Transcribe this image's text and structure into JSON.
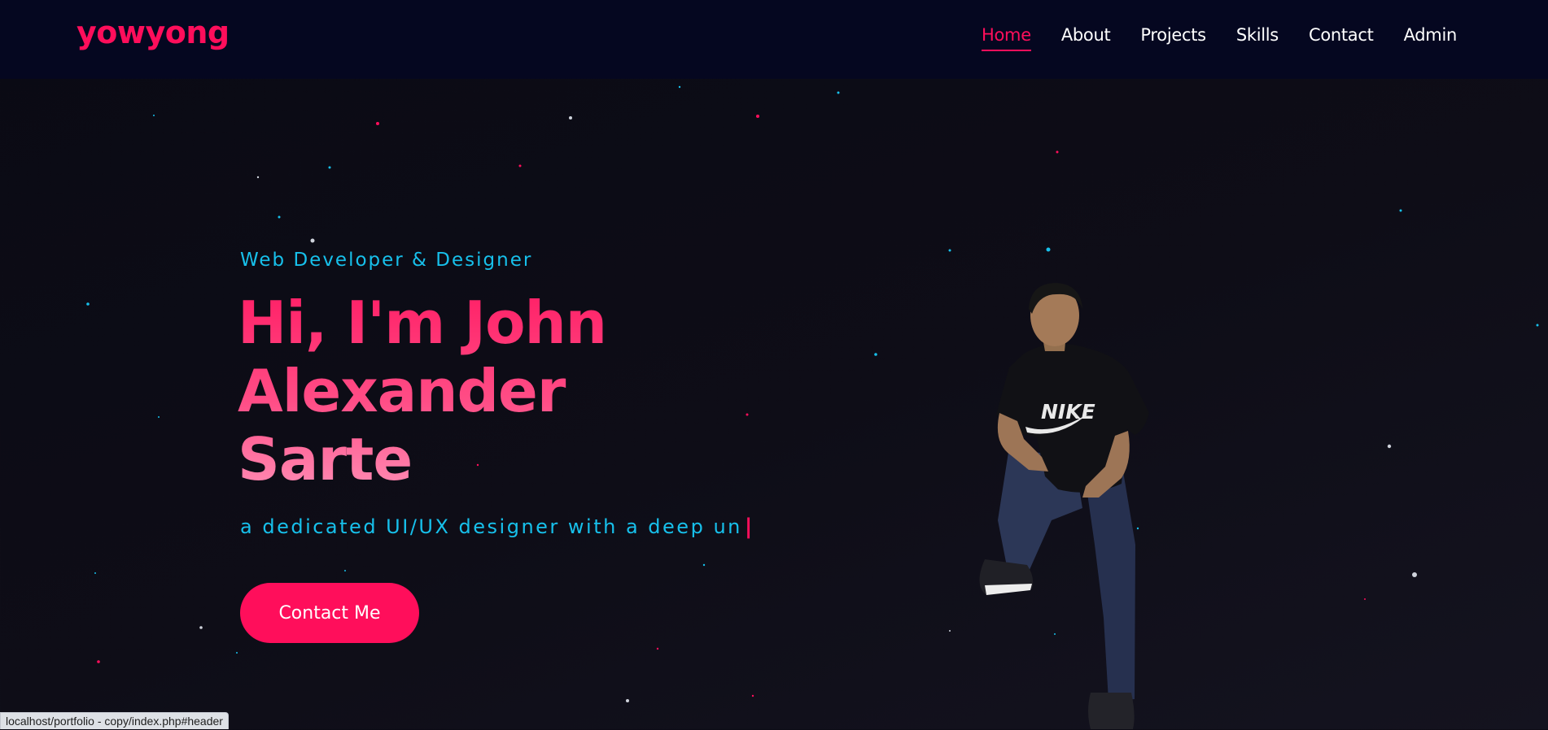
{
  "header": {
    "logo": "yowyong",
    "nav": [
      "Home",
      "About",
      "Projects",
      "Skills",
      "Contact",
      "Admin"
    ],
    "active": "Home"
  },
  "hero": {
    "subtitle": "Web Developer & Designer",
    "headline": [
      "Hi, I'm John",
      "Alexander",
      "Sarte"
    ],
    "tagline": "a dedicated UI/UX designer with a deep un",
    "cta_label": "Contact Me"
  },
  "status_bar": {
    "url": "localhost/portfolio - copy/index.php#header"
  },
  "colors": {
    "accent": "#ff0e5b",
    "cyan": "#17c0eb",
    "nav_bg": "#050720",
    "page_bg": "#0e0d17"
  }
}
